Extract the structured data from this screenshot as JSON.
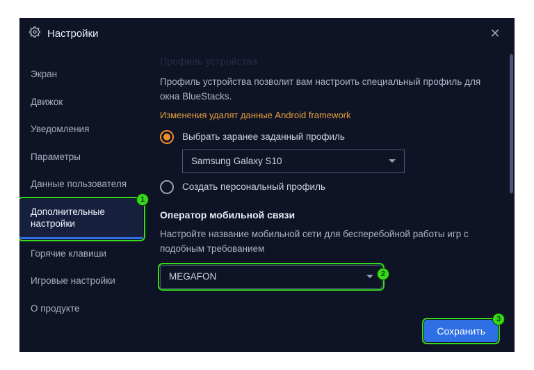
{
  "window": {
    "title": "Настройки",
    "close_glyph": "✕"
  },
  "sidebar": {
    "items": [
      {
        "label": "Экран"
      },
      {
        "label": "Движок"
      },
      {
        "label": "Уведомления"
      },
      {
        "label": "Параметры"
      },
      {
        "label": "Данные пользователя"
      },
      {
        "label": "Дополнительные настройки"
      },
      {
        "label": "Горячие клавиши"
      },
      {
        "label": "Игровые настройки"
      },
      {
        "label": "О продукте"
      }
    ],
    "active_index": 5
  },
  "content": {
    "partial_header": "Профиль устройства",
    "device_profile_desc": "Профиль устройства позволит вам настроить специальный профиль для окна BlueStacks.",
    "warning": "Изменения удалят данные Android framework",
    "radio_preset_label": "Выбрать заранее заданный профиль",
    "preset_value": "Samsung Galaxy S10",
    "radio_custom_label": "Создать персональный профиль",
    "carrier_heading": "Оператор мобильной связи",
    "carrier_desc": "Настройте название мобильной сети для бесперебойной работы игр с подобным требованием",
    "carrier_value": "MEGAFON",
    "save_label": "Сохранить"
  },
  "annotations": {
    "b1": "1",
    "b2": "2",
    "b3": "3"
  }
}
